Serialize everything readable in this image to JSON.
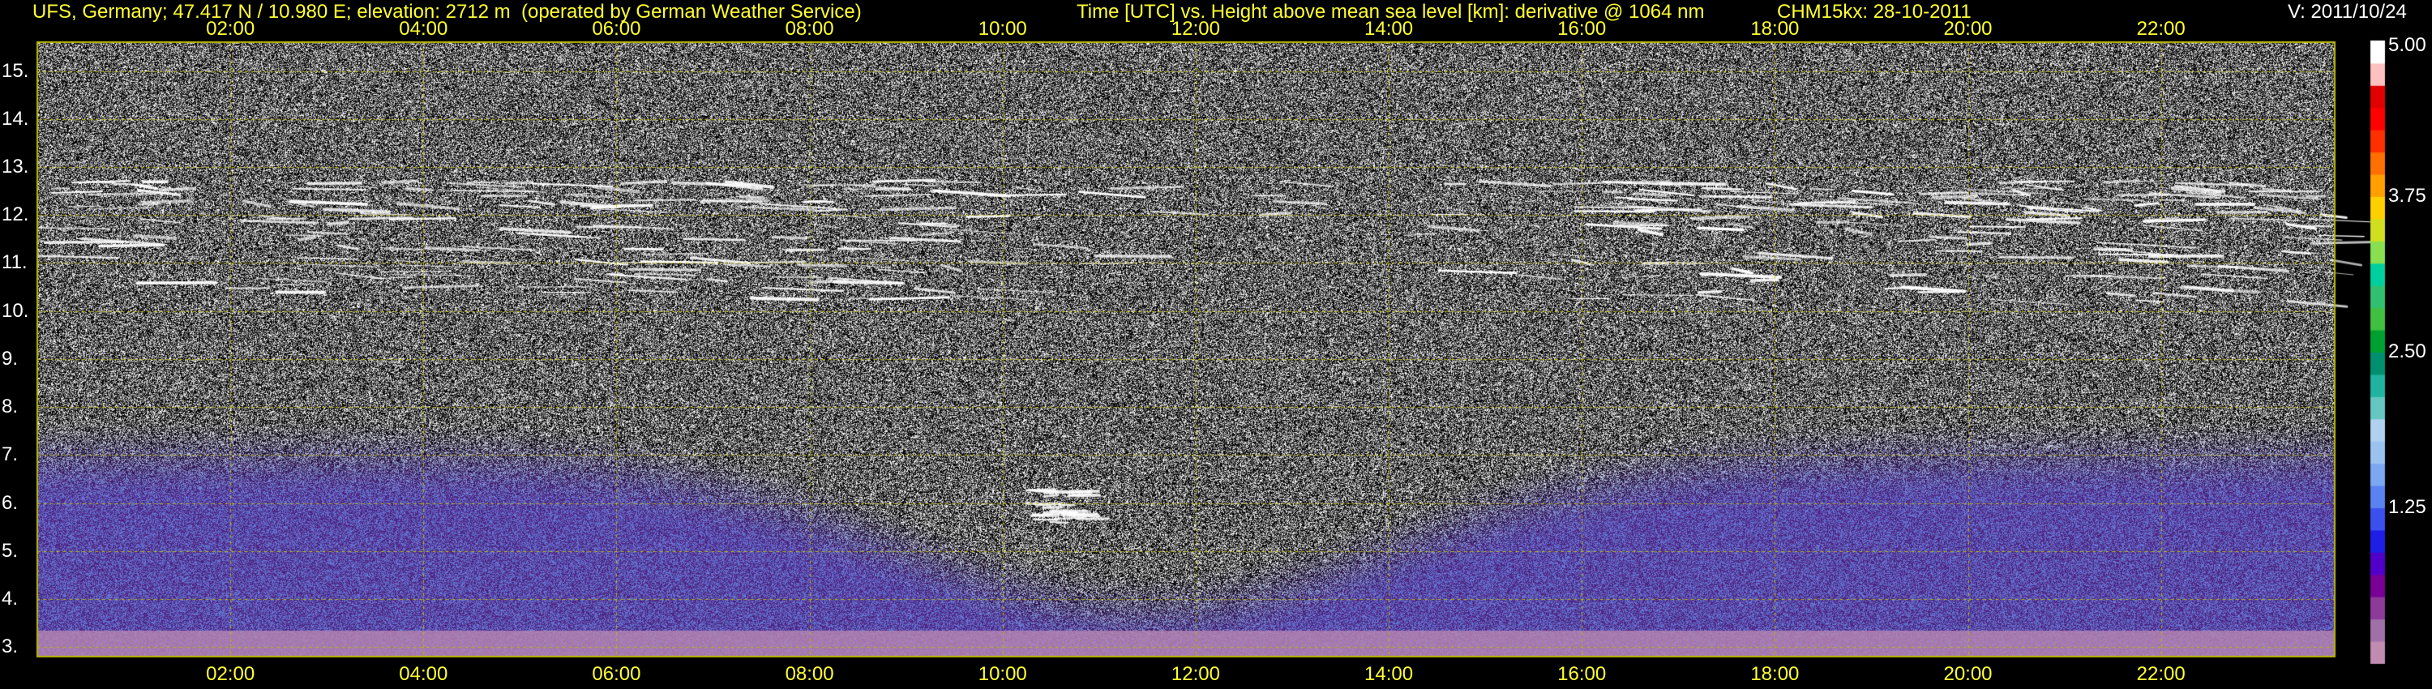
{
  "header": {
    "station": "UFS, Germany; 47.417 N / 10.980 E; elevation: 2712 m  (operated by German Weather Service)",
    "title": "Time [UTC] vs. Height above mean sea level [km]: derivative @ 1064 nm",
    "instrument": "CHM15kx: 28-10-2011",
    "version": "V: 2011/10/24"
  },
  "colors": {
    "text_yellow": "#ffff33",
    "text_white": "#ffffff",
    "grid": "#b8b800",
    "background": "#000000"
  },
  "chart_data": {
    "type": "heatmap",
    "title": "Time [UTC] vs. Height above mean sea level [km]: derivative @ 1064 nm",
    "xlabel": "",
    "ylabel": "",
    "x_unit": "hour UTC",
    "xlim": [
      0,
      23.8
    ],
    "ylim": [
      2.8,
      15.6
    ],
    "x_ticks": [
      {
        "value": 2,
        "label": "02:00"
      },
      {
        "value": 4,
        "label": "04:00"
      },
      {
        "value": 6,
        "label": "06:00"
      },
      {
        "value": 8,
        "label": "08:00"
      },
      {
        "value": 10,
        "label": "10:00"
      },
      {
        "value": 12,
        "label": "12:00"
      },
      {
        "value": 14,
        "label": "14:00"
      },
      {
        "value": 16,
        "label": "16:00"
      },
      {
        "value": 18,
        "label": "18:00"
      },
      {
        "value": 20,
        "label": "20:00"
      },
      {
        "value": 22,
        "label": "22:00"
      }
    ],
    "y_ticks": [
      {
        "value": 3,
        "label": "3."
      },
      {
        "value": 4,
        "label": "4."
      },
      {
        "value": 5,
        "label": "5."
      },
      {
        "value": 6,
        "label": "6."
      },
      {
        "value": 7,
        "label": "7."
      },
      {
        "value": 8,
        "label": "8."
      },
      {
        "value": 9,
        "label": "9."
      },
      {
        "value": 10,
        "label": "10."
      },
      {
        "value": 11,
        "label": "11."
      },
      {
        "value": 12,
        "label": "12."
      },
      {
        "value": 13,
        "label": "13."
      },
      {
        "value": 14,
        "label": "14."
      },
      {
        "value": 15,
        "label": "15."
      }
    ],
    "grid": true,
    "colorbar": {
      "range": [
        0,
        5
      ],
      "labels": [
        "5.00",
        "3.75",
        "2.50",
        "1.25"
      ],
      "label_values": [
        5.0,
        3.75,
        2.5,
        1.25
      ],
      "colors": [
        "#c08cb0",
        "#a070a8",
        "#8c3c98",
        "#780096",
        "#5000c8",
        "#1e1ee6",
        "#3c50f0",
        "#5a82f0",
        "#7ba8f0",
        "#9cc3f0",
        "#b0d2f0",
        "#64c8c0",
        "#20b4a0",
        "#009070",
        "#00a030",
        "#40c040",
        "#30c070",
        "#00d0a0",
        "#88e050",
        "#d0e020",
        "#ffd000",
        "#ffa000",
        "#ff7000",
        "#ff3000",
        "#ff0000",
        "#e00000",
        "#ffc0c0",
        "#ffffff"
      ]
    },
    "features": [
      {
        "type": "cirrus_layer",
        "time_range": [
          0.0,
          23.8
        ],
        "height_range": [
          10.2,
          12.7
        ]
      },
      {
        "type": "small_cloud",
        "time": 10.4,
        "height_range": [
          5.6,
          6.3
        ]
      },
      {
        "type": "aerosol_boundary_layer",
        "time_range": [
          0.0,
          23.8
        ],
        "height_range": [
          2.9,
          3.4
        ]
      }
    ]
  }
}
